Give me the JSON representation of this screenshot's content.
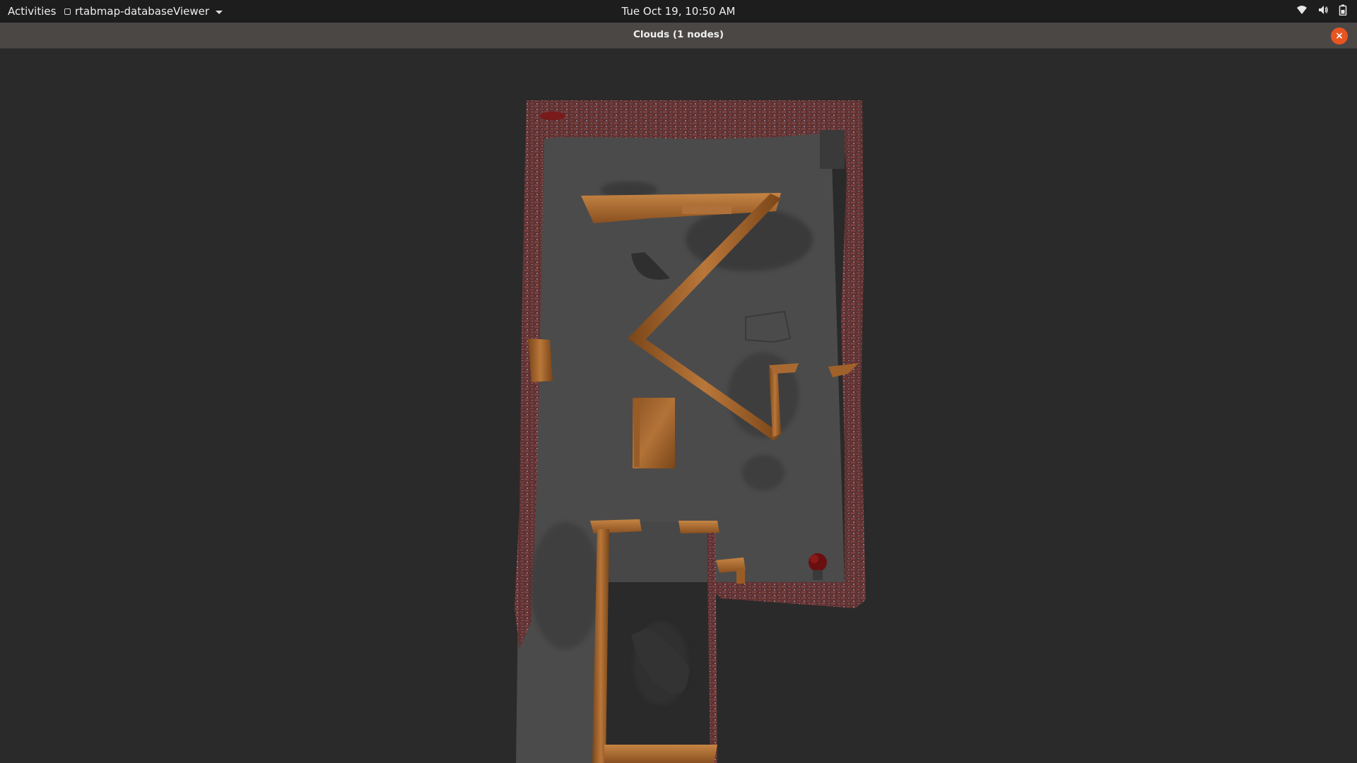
{
  "topbar": {
    "activities_label": "Activities",
    "app_name": "rtabmap-databaseViewer",
    "clock": "Tue Oct 19, 10:50 AM",
    "tray_icons": [
      "wifi-icon",
      "volume-icon",
      "battery-icon"
    ]
  },
  "window": {
    "title": "Clouds (1 nodes)",
    "close_icon": "×"
  },
  "colors": {
    "topbar_bg": "#1d1d1d",
    "titlebar_bg": "#4a4745",
    "viewport_bg": "#2a2a2a",
    "close_accent": "#e95420",
    "floor": "#4a4a4a",
    "wall_brick": "#6b3a3a",
    "wood": "#a0622a"
  }
}
